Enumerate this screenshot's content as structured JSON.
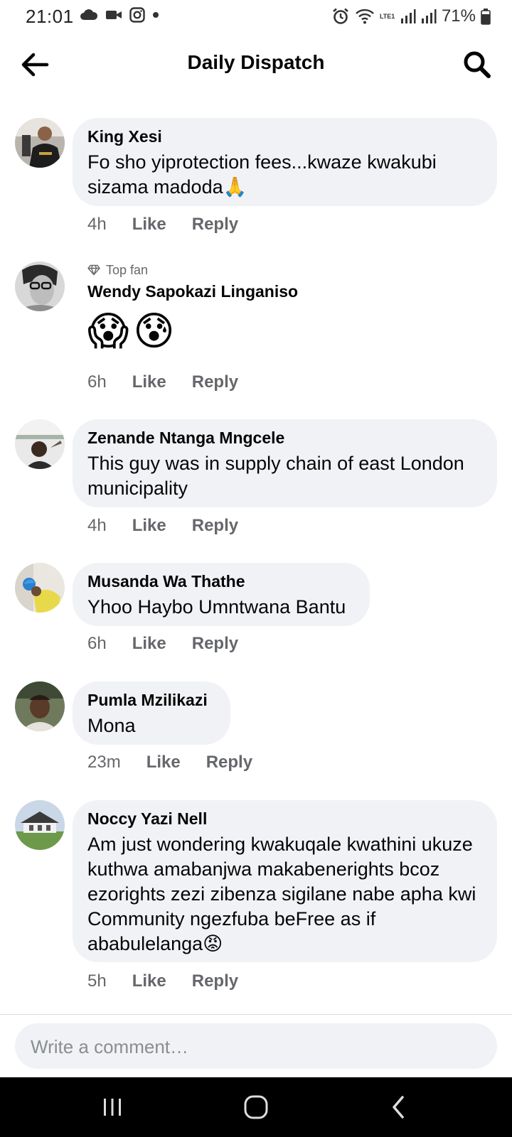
{
  "status_bar": {
    "time": "21:01",
    "battery_percent": "71%",
    "network": "LTE1"
  },
  "header": {
    "title": "Daily Dispatch"
  },
  "comments": [
    {
      "author": "King Xesi",
      "text": "Fo sho yiprotection fees...kwaze kwakubi sizama madoda",
      "emoji": "🙏",
      "time": "4h",
      "like": "Like",
      "reply": "Reply"
    },
    {
      "badge": "Top fan",
      "author": "Wendy Sapokazi Linganiso",
      "emojis": [
        "😱",
        "😰"
      ],
      "time": "6h",
      "like": "Like",
      "reply": "Reply"
    },
    {
      "author": "Zenande Ntanga Mngcele",
      "text": "This guy was in supply chain of east London municipality",
      "time": "4h",
      "like": "Like",
      "reply": "Reply"
    },
    {
      "author": "Musanda Wa Thathe",
      "text": "Yhoo Haybo Umntwana Bantu",
      "time": "6h",
      "like": "Like",
      "reply": "Reply"
    },
    {
      "author": "Pumla Mzilikazi",
      "text": "Mona",
      "time": "23m",
      "like": "Like",
      "reply": "Reply"
    },
    {
      "author": "Noccy Yazi Nell",
      "text": "Am just wondering kwakuqale kwathini ukuze kuthwa amabanjwa makabenerights bcoz ezorights zezi zibenza sigilane nabe apha kwi Community ngezfuba beFree as if ababulelanga",
      "emoji": "😡",
      "time": "5h",
      "like": "Like",
      "reply": "Reply"
    }
  ],
  "composer": {
    "placeholder": "Write a comment…"
  },
  "colors": {
    "bubble": "#f0f2f5",
    "meta_text": "#65676b",
    "nav_bar": "#000000"
  },
  "icons": [
    "back-arrow-icon",
    "search-icon",
    "diamond-icon",
    "recents-icon",
    "home-icon",
    "back-nav-icon"
  ]
}
